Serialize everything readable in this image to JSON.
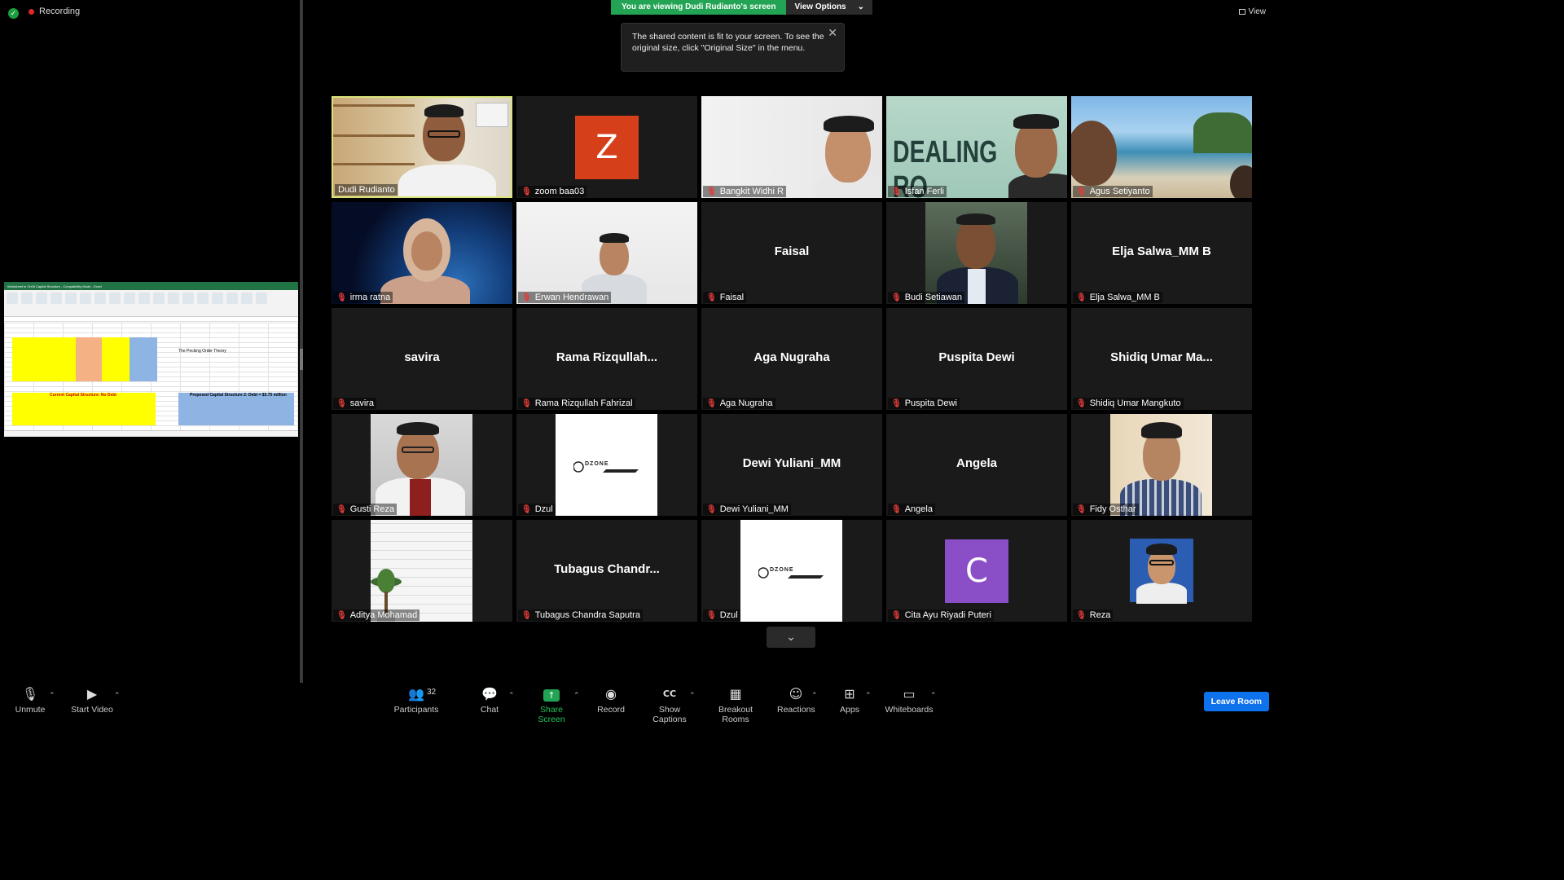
{
  "status": {
    "recording_label": "Recording"
  },
  "banner": {
    "viewing_text": "You are viewing Dudi Rudianto's screen",
    "view_options_label": "View Options"
  },
  "tooltip": {
    "text": "The shared content is fit to your screen. To see the original size, click \"Original Size\" in the menu."
  },
  "view_button": {
    "label": "View"
  },
  "shared_screen": {
    "window_title": "Worksheet in Ch06 Capital Structure - Compatibility Mode - Excel",
    "cell_heading": "The Pecking Order Theory",
    "current_table_title": "Current Capital Structure: No Debt",
    "proposed_table_title": "Proposed Capital Structure 2: Debt = $3.75 million"
  },
  "participants": [
    {
      "name": "Dudi Rudianto",
      "display": "",
      "active": true,
      "muted": false,
      "kind": "video"
    },
    {
      "name": "zoom baa03",
      "display": "",
      "initial": "Z",
      "avatar_color": "#d5401a",
      "muted": true,
      "kind": "avatar"
    },
    {
      "name": "Bangkit Widhi R",
      "display": "",
      "muted": true,
      "kind": "video"
    },
    {
      "name": "Isfan Ferli",
      "display": "",
      "muted": true,
      "kind": "video"
    },
    {
      "name": "Agus Setiyanto",
      "display": "",
      "muted": true,
      "kind": "video"
    },
    {
      "name": "irma ratna",
      "display": "",
      "muted": true,
      "kind": "video"
    },
    {
      "name": "Erwan Hendrawan",
      "display": "",
      "muted": true,
      "kind": "video"
    },
    {
      "name": "Faisal",
      "display": "Faisal",
      "muted": true,
      "kind": "name"
    },
    {
      "name": "Budi Setiawan",
      "display": "",
      "muted": true,
      "kind": "photo"
    },
    {
      "name": "Elja Salwa_MM B",
      "display": "Elja Salwa_MM B",
      "muted": true,
      "kind": "name"
    },
    {
      "name": "savira",
      "display": "savira",
      "muted": true,
      "kind": "name"
    },
    {
      "name": "Rama Rizqullah Fahrizal",
      "display": "Rama  Rizqullah...",
      "muted": true,
      "kind": "name"
    },
    {
      "name": "Aga Nugraha",
      "display": "Aga Nugraha",
      "muted": true,
      "kind": "name"
    },
    {
      "name": "Puspita Dewi",
      "display": "Puspita Dewi",
      "muted": true,
      "kind": "name"
    },
    {
      "name": "Shidiq Umar Mangkuto",
      "display": "Shidiq Umar Ma...",
      "muted": true,
      "kind": "name"
    },
    {
      "name": "Gusti Reza",
      "display": "",
      "muted": true,
      "kind": "photo"
    },
    {
      "name": "Dzul",
      "display": "",
      "logo": "DZONE",
      "muted": true,
      "kind": "logo"
    },
    {
      "name": "Dewi Yuliani_MM",
      "display": "Dewi Yuliani_MM",
      "muted": true,
      "kind": "name"
    },
    {
      "name": "Angela",
      "display": "Angela",
      "muted": true,
      "kind": "name"
    },
    {
      "name": "Fidy Osthar",
      "display": "",
      "muted": true,
      "kind": "photo"
    },
    {
      "name": "Aditya Mohamad",
      "display": "",
      "muted": true,
      "kind": "photo"
    },
    {
      "name": "Tubagus Chandra Saputra",
      "display": "Tubagus  Chandr...",
      "muted": true,
      "kind": "name"
    },
    {
      "name": "Dzul",
      "display": "",
      "logo": "DZONE",
      "muted": true,
      "kind": "logo"
    },
    {
      "name": "Cita Ayu Riyadi Puteri",
      "display": "",
      "initial": "C",
      "avatar_color": "#8a4fc7",
      "muted": true,
      "kind": "avatar"
    },
    {
      "name": "Reza",
      "display": "",
      "muted": true,
      "kind": "photo"
    }
  ],
  "toolbar": {
    "unmute": "Unmute",
    "start_video": "Start Video",
    "participants": "Participants",
    "participant_count": "32",
    "chat": "Chat",
    "share_screen": "Share Screen",
    "record": "Record",
    "show_captions": "Show Captions",
    "breakout_rooms": "Breakout Rooms",
    "reactions": "Reactions",
    "apps": "Apps",
    "whiteboards": "Whiteboards",
    "leave_room": "Leave Room"
  }
}
